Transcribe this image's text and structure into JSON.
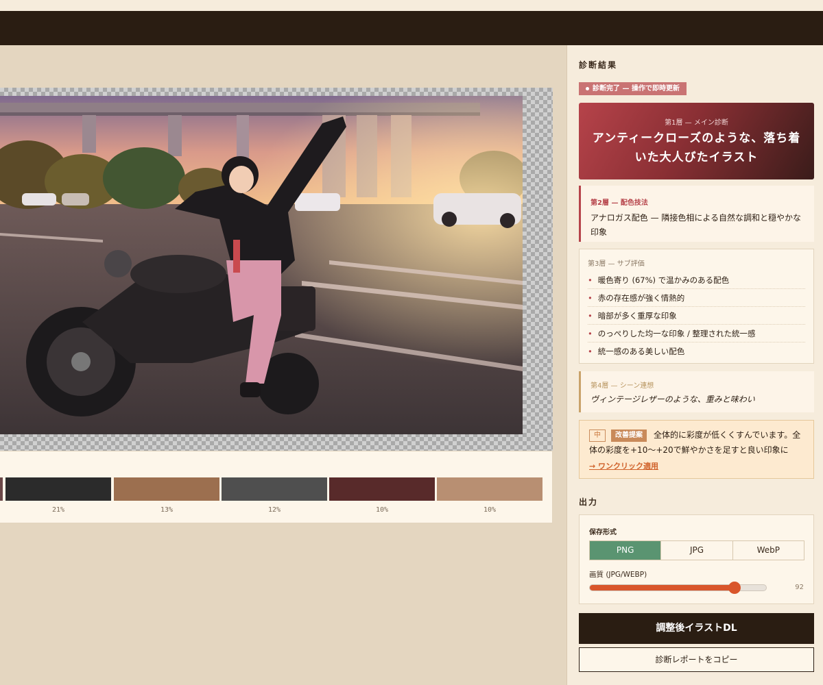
{
  "side": {
    "diag_title": "診断結果",
    "status_text": "診断完了 — 操作で即時更新",
    "layer1": {
      "label": "第1層 — メイン診断",
      "text": "アンティークローズのような、落ち着いた大人びたイラスト"
    },
    "layer2": {
      "label": "第2層 — 配色技法",
      "text": "アナロガス配色 — 隣接色相による自然な調和と穏やかな印象"
    },
    "layer3": {
      "label": "第3層 — サブ評価",
      "items": [
        "暖色寄り (67%) で温かみのある配色",
        "赤の存在感が強く情熱的",
        "暗部が多く重厚な印象",
        "のっぺりした均一な印象 / 整理された統一感",
        "統一感のある美しい配色"
      ]
    },
    "layer4": {
      "label": "第4層 — シーン連想",
      "text": "ヴィンテージレザーのような、重みと味わい"
    },
    "suggestion": {
      "level": "中",
      "badge": "改善提案",
      "text": "全体的に彩度が低くくすんでいます。全体の彩度を+10〜+20で鮮やかさを足すと良い印象に",
      "link": "→ ワンクリック適用"
    },
    "output": {
      "title": "出力",
      "format_label": "保存形式",
      "formats": [
        "PNG",
        "JPG",
        "WebP"
      ],
      "selected_format": "PNG",
      "quality_label": "画質 (JPG/WEBP)",
      "quality": 92,
      "quality_max": 100,
      "download_label": "調整後イラストDL",
      "copy_label": "診断レポートをコピー"
    }
  },
  "palette": {
    "swatches": [
      {
        "color": "#6b4848",
        "percent": ""
      },
      {
        "color": "#2b2b2b",
        "percent": "21%"
      },
      {
        "color": "#9c6f4f",
        "percent": "13%"
      },
      {
        "color": "#4f4f4f",
        "percent": "12%"
      },
      {
        "color": "#582a2a",
        "percent": "10%"
      },
      {
        "color": "#b88f72",
        "percent": "10%"
      }
    ]
  },
  "colors": {
    "dark": "#2a1d12",
    "accent_red": "#b6434a",
    "accent_green": "#5a9471",
    "accent_orange": "#d9562b"
  }
}
